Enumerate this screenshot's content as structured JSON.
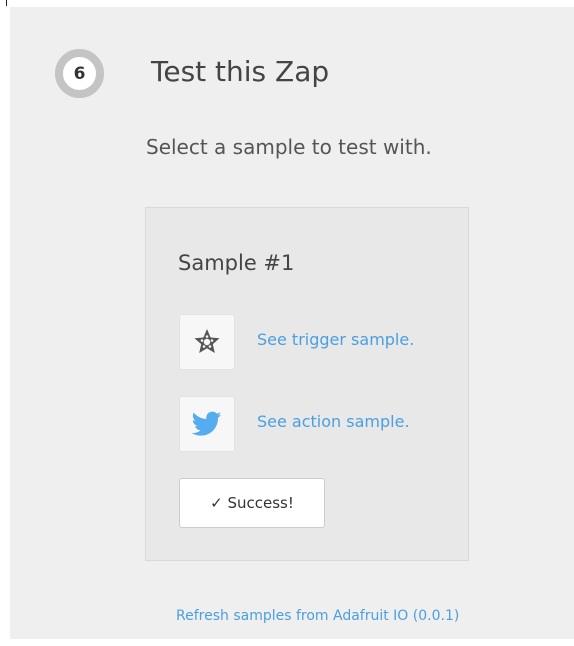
{
  "step": {
    "number": "6",
    "title": "Test this Zap"
  },
  "subtitle": "Select a sample to test with.",
  "sample": {
    "heading": "Sample #1",
    "trigger_icon": "adafruit-star-icon",
    "trigger_link": "See trigger sample.",
    "action_icon": "twitter-bird-icon",
    "action_link": "See action sample.",
    "status_button": "✓ Success!"
  },
  "refresh_link": "Refresh samples from Adafruit IO (0.0.1)",
  "colors": {
    "link": "#4a9fe0",
    "twitter": "#55acee",
    "step_ring": "#c4c4c4"
  }
}
